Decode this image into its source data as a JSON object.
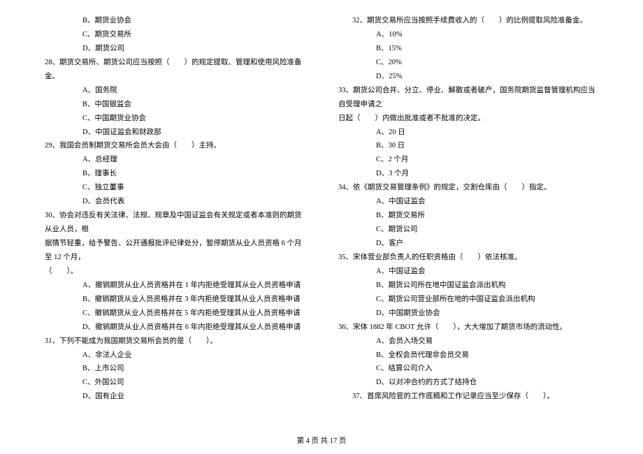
{
  "left_options_27": {
    "b": "B、期货业协会",
    "c": "C、期货交易所",
    "d": "D、期货公司"
  },
  "q28": {
    "stem": "28、期货交易所、期货公司应当按照（　　）的规定提取、管理和使用风险准备金。",
    "a": "A、国务院",
    "b": "B、中国银监会",
    "c": "C、中国期货业协会",
    "d": "D、中国证监会和财政部"
  },
  "q29": {
    "stem": "29、我国会员制期货交易所会员大会由（　　）主持。",
    "a": "A、总经理",
    "b": "B、理事长",
    "c": "C、独立董事",
    "d": "D、会员代表"
  },
  "q30": {
    "stem1": "30、协会对违反有关法律、法规、规章及中国证监会有关规定或者本准则的期货从业人员，根",
    "stem2": "据情节轻重，给予警告、公开通报批评纪律处分，暂停期货从业人员资格 6 个月至 12 个月，",
    "stem3": "（　　）。",
    "a": "A、撤销期货从业人员资格并在 1 年内拒绝受理其从业人员资格申请",
    "b": "B、撤销期货从业人员资格并在 3 年内拒绝受理其从业人员资格申请",
    "c": "C、撤销期货从业人员资格并在 5 年内拒绝受理其从业人员资格申请",
    "d": "D、撤销期货从业人员资格并在 6 年内拒绝受理其从业人员资格申请"
  },
  "q31": {
    "stem": "31、下列不能成为我国期货交易所会员的是（　　）。",
    "a": "A、非法人企业",
    "b": "B、上市公司",
    "c": "C、外国公司",
    "d": "D、国有企业"
  },
  "q32": {
    "stem": "32、期货交易所应当按照手续费收入的（　　）的比例提取风险准备金。",
    "a": "A、10%",
    "b": "B、15%",
    "c": "C、20%",
    "d": "D、25%"
  },
  "q33": {
    "stem1": "33、期货公司合并、分立、停业、解散或者破产，国务院期货监督管理机构应当自受理申请之",
    "stem2": "日起（　　）内做出批准或者不批准的决定。",
    "a": "A、20 日",
    "b": "B、30 日",
    "c": "C、2 个月",
    "d": "D、3 个月"
  },
  "q34": {
    "stem": "34、依《期货交易管理条例》的规定，交割仓库由（　　）指定。",
    "a": "A、中国证监会",
    "b": "B、期货交易所",
    "c": "C、期货公司",
    "d": "D、客户"
  },
  "q35": {
    "stem": "35、宋体营业部负责人的任职资格由（　　）依法核准。",
    "a": "A、中国证监会",
    "b": "B、期货公司所在地中国证监会派出机构",
    "c": "C、期货公司营业部所在地的中国证监会派出机构",
    "d": "D、中国期货业协会"
  },
  "q36": {
    "stem": "36、宋体 1882 年 CBOT 允许（　　），大大增加了期货市场的流动性。",
    "a": "A、会员入场交易",
    "b": "B、全权会员代理非会员交易",
    "c": "C、结算公司介入",
    "d": "D、以对冲合约的方式了结持仓"
  },
  "q37": {
    "stem": "37、首席风险官的工作底稿和工作记录应当至少保存（　　）。"
  },
  "footer": "第 4 页 共 17 页"
}
